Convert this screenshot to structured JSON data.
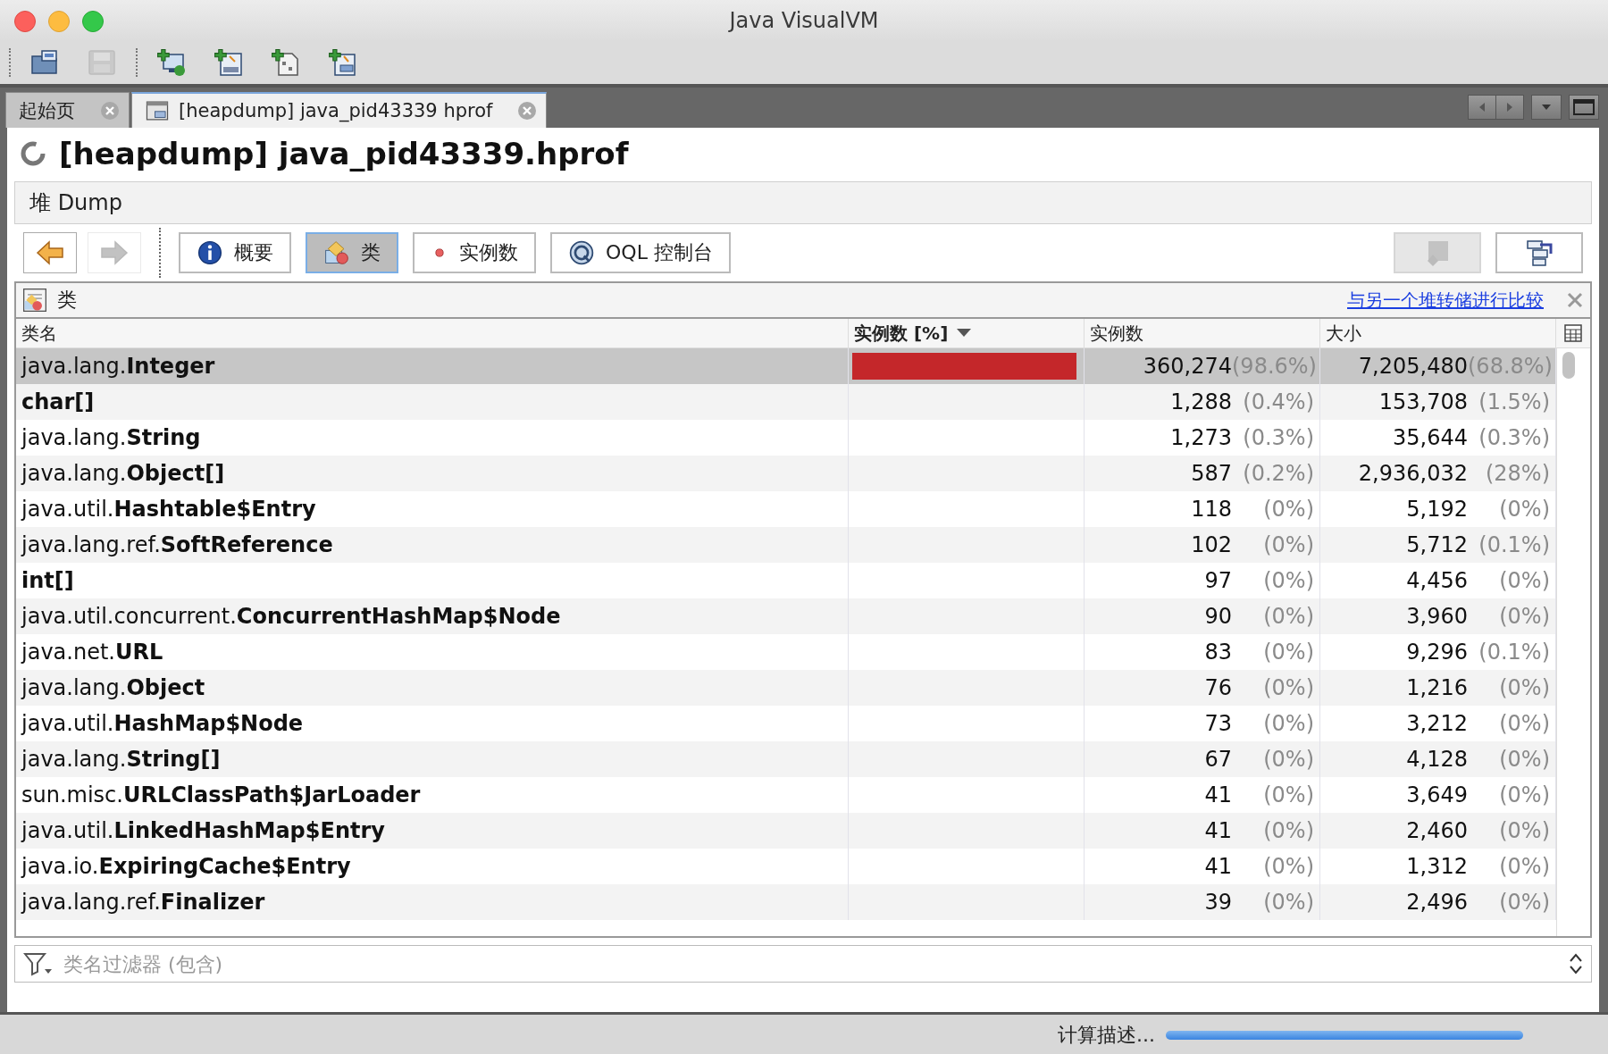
{
  "window": {
    "title": "Java VisualVM"
  },
  "toolbar": [
    {
      "kind": "open",
      "disabled": false
    },
    {
      "kind": "save",
      "disabled": true
    },
    {
      "kind": "add-host",
      "disabled": false
    },
    {
      "kind": "add-jmx",
      "disabled": false
    },
    {
      "kind": "add-dump",
      "disabled": false
    },
    {
      "kind": "add-snapshot",
      "disabled": false
    }
  ],
  "tabs": [
    {
      "label": "起始页",
      "selected": false,
      "kind": "start"
    },
    {
      "label": "[heapdump] java_pid43339 hprof",
      "selected": true,
      "kind": "heapdump"
    }
  ],
  "header": {
    "title": "[heapdump] java_pid43339.hprof",
    "subtitle": "堆 Dump"
  },
  "nav": [
    {
      "kind": "back",
      "disabled": false
    },
    {
      "kind": "forward",
      "disabled": true
    }
  ],
  "views": [
    {
      "label": "概要",
      "kind": "summary",
      "selected": false
    },
    {
      "label": "类",
      "kind": "classes",
      "selected": true
    },
    {
      "label": "实例数",
      "kind": "instances",
      "selected": false
    },
    {
      "label": "OQL 控制台",
      "kind": "oql",
      "selected": false
    }
  ],
  "actions": [
    {
      "kind": "find",
      "disabled": true
    },
    {
      "kind": "export",
      "disabled": false
    }
  ],
  "classes": {
    "title": "类",
    "compare_link": "与另一个堆转储进行比较",
    "columns": [
      {
        "label": "类名",
        "sorted": false
      },
      {
        "label": "实例数 [%]",
        "sorted": true
      },
      {
        "label": "实例数",
        "sorted": false
      },
      {
        "label": "大小",
        "sorted": false
      }
    ],
    "rows": [
      {
        "name": "java.lang.**Integer**",
        "level": 0.986,
        "count": "360,274",
        "count_pct": "(98.6%)",
        "size": "7,205,480",
        "size_pct": "(68.8%)",
        "selected": true
      },
      {
        "name": "**char[]**",
        "count": "1,288",
        "count_pct": "(0.4%)",
        "size": "153,708",
        "size_pct": "(1.5%)",
        "selected": false
      },
      {
        "name": "java.lang.**String**",
        "count": "1,273",
        "count_pct": "(0.3%)",
        "size": "35,644",
        "size_pct": "(0.3%)",
        "selected": false
      },
      {
        "name": "java.lang.**Object[]**",
        "count": "587",
        "count_pct": "(0.2%)",
        "size": "2,936,032",
        "size_pct": "(28%)",
        "selected": false
      },
      {
        "name": "java.util.**Hashtable$Entry**",
        "count": "118",
        "count_pct": "(0%)",
        "size": "5,192",
        "size_pct": "(0%)",
        "selected": false
      },
      {
        "name": "java.lang.ref.**SoftReference**",
        "count": "102",
        "count_pct": "(0%)",
        "size": "5,712",
        "size_pct": "(0.1%)",
        "selected": false
      },
      {
        "name": "**int[]**",
        "count": "97",
        "count_pct": "(0%)",
        "size": "4,456",
        "size_pct": "(0%)",
        "selected": false
      },
      {
        "name": "java.util.concurrent.**ConcurrentHashMap$Node**",
        "count": "90",
        "count_pct": "(0%)",
        "size": "3,960",
        "size_pct": "(0%)",
        "selected": false
      },
      {
        "name": "java.net.**URL**",
        "count": "83",
        "count_pct": "(0%)",
        "size": "9,296",
        "size_pct": "(0.1%)",
        "selected": false
      },
      {
        "name": "java.lang.**Object**",
        "count": "76",
        "count_pct": "(0%)",
        "size": "1,216",
        "size_pct": "(0%)",
        "selected": false
      },
      {
        "name": "java.util.**HashMap$Node**",
        "count": "73",
        "count_pct": "(0%)",
        "size": "3,212",
        "size_pct": "(0%)",
        "selected": false
      },
      {
        "name": "java.lang.**String[]**",
        "count": "67",
        "count_pct": "(0%)",
        "size": "4,128",
        "size_pct": "(0%)",
        "selected": false
      },
      {
        "name": "sun.misc.**URLClassPath$JarLoader**",
        "count": "41",
        "count_pct": "(0%)",
        "size": "3,649",
        "size_pct": "(0%)",
        "selected": false
      },
      {
        "name": "java.util.**LinkedHashMap$Entry**",
        "count": "41",
        "count_pct": "(0%)",
        "size": "2,460",
        "size_pct": "(0%)",
        "selected": false
      },
      {
        "name": "java.io.**ExpiringCache$Entry**",
        "count": "41",
        "count_pct": "(0%)",
        "size": "1,312",
        "size_pct": "(0%)",
        "selected": false
      },
      {
        "name": "java.lang.ref.**Finalizer**",
        "count": "39",
        "count_pct": "(0%)",
        "size": "2,496",
        "size_pct": "(0%)",
        "selected": false
      }
    ],
    "filter": {
      "placeholder": "类名过滤器 (包含)"
    }
  },
  "status": {
    "text": "计算描述...",
    "level": 1
  }
}
